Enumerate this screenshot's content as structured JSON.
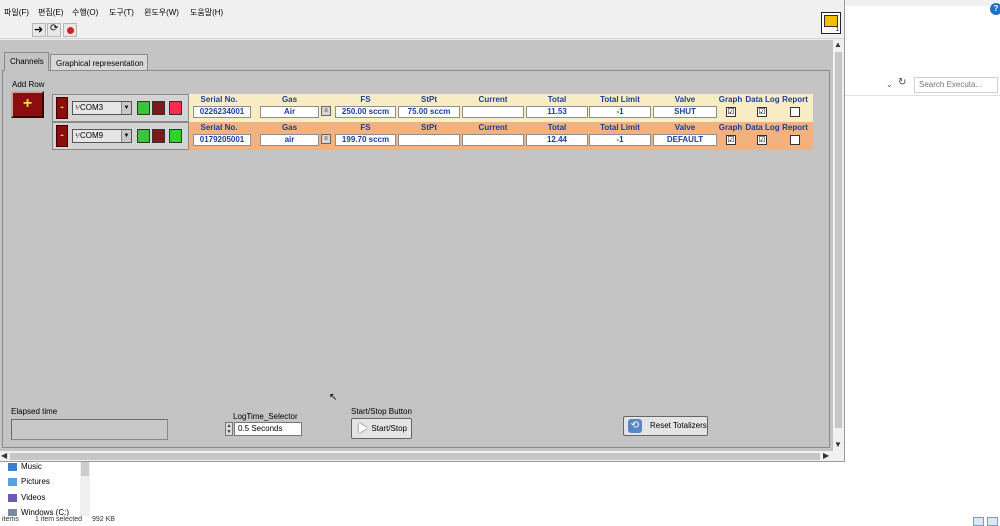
{
  "explorer": {
    "search_placeholder": "Search Executa...",
    "nav": [
      "Music",
      "Pictures",
      "Videos",
      "Windows (C:)"
    ],
    "status_items": "items",
    "status_selected": "1 item selected",
    "status_size": "992 KB",
    "help_glyph": "?"
  },
  "menu": [
    "파일(F)",
    "편집(E)",
    "수행(O)",
    "도구(T)",
    "윈도우(W)",
    "도움말(H)"
  ],
  "vi_icon_num": "1",
  "tabs": {
    "channels": "Channels",
    "graphical": "Graphical representation"
  },
  "add_row": {
    "label": "Add Row",
    "glyph": "+"
  },
  "columns": {
    "serial": "Serial No.",
    "gas": "Gas",
    "fs": "FS",
    "stpt": "StPt",
    "current": "Current",
    "total": "Total",
    "total_limit": "Total Limit",
    "valve": "Valve",
    "graph": "Graph",
    "data_log": "Data Log",
    "report": "Report"
  },
  "channels": [
    {
      "remove_glyph": "-",
      "com": "COM3",
      "status_color": "#ff2d4d",
      "serial": "0226234001",
      "gas": "Air",
      "fs": "250.00 sccm",
      "stpt": "75.00 sccm",
      "current": "",
      "total": "11.53",
      "total_limit": "-1",
      "valve": "SHUT",
      "graph": "☑",
      "data_log": "☑",
      "report": ""
    },
    {
      "remove_glyph": "-",
      "com": "COM9",
      "status_color": "#2bd42b",
      "serial": "0179205001",
      "gas": "air",
      "fs": "199.70 sccm",
      "stpt": "",
      "current": "",
      "total": "12.44",
      "total_limit": "-1",
      "valve": "DEFAULT",
      "graph": "☑",
      "data_log": "☑",
      "report": ""
    }
  ],
  "elapsed": {
    "label": "Elapsed time",
    "value": ""
  },
  "logtime": {
    "label": "LogTime_Selector",
    "value": "0.5 Seconds"
  },
  "start_stop": {
    "label": "Start/Stop Button",
    "button": "Start/Stop"
  },
  "reset": {
    "button": "Reset Totalizers"
  }
}
